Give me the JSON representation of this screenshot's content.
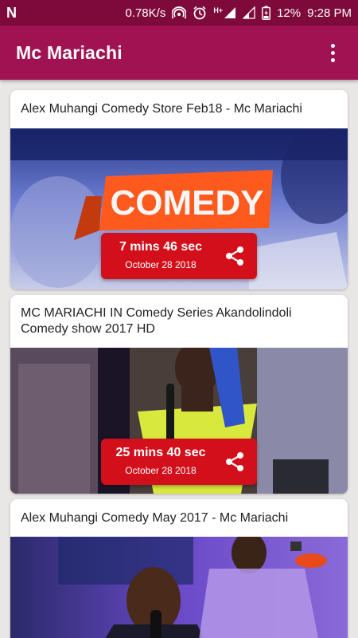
{
  "status_bar": {
    "notification_icon": "n-icon",
    "net_speed": "0.78K/s",
    "network_type": "H+",
    "battery": "12%",
    "time": "9:28 PM"
  },
  "app_bar": {
    "title": "Mc Mariachi",
    "menu_icon": "more-vert-icon"
  },
  "videos": [
    {
      "title": "Alex Muhangi Comedy Store Feb18 - Mc Mariachi",
      "duration": "7 mins 46 sec",
      "date": "October 28 2018",
      "thumbnail_text": "COMEDY"
    },
    {
      "title": "MC MARIACHI IN Comedy Series Akandolindoli Comedy show 2017 HD",
      "duration": "25 mins 40 sec",
      "date": "October 28 2018"
    },
    {
      "title": "Alex Muhangi Comedy May 2017 - Mc Mariachi"
    }
  ],
  "colors": {
    "app_bar": "#a01252",
    "status_bar": "#7d0a3b",
    "badge": "#d20f1a"
  }
}
